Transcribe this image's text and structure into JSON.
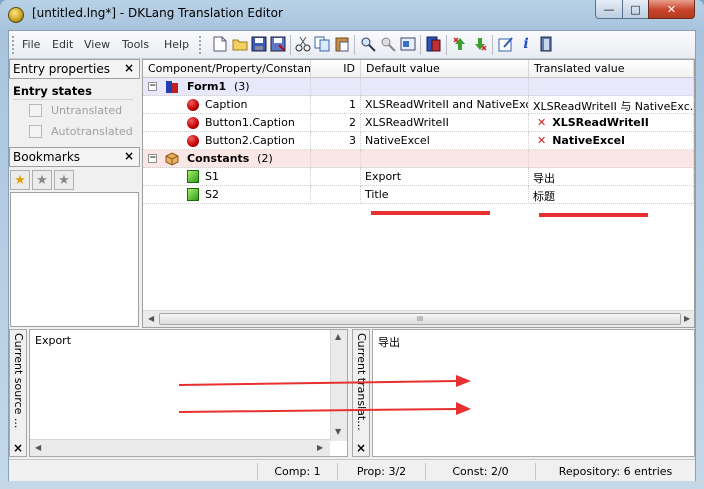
{
  "window": {
    "title": "[untitled.lng*] - DKLang Translation Editor",
    "min_glyph": "—",
    "max_glyph": "□",
    "close_glyph": "✕"
  },
  "menu": [
    "File",
    "Edit",
    "View",
    "Tools",
    "Help"
  ],
  "toolbar_icons": [
    "new-icon",
    "open-icon",
    "save-icon",
    "save-as-icon",
    "cut-icon",
    "copy-icon",
    "paste-icon",
    "find-icon",
    "replace-icon",
    "properties-icon",
    "translation-icon",
    "jump-prev-icon",
    "jump-next-icon",
    "edit-icon",
    "info-icon",
    "exit-icon"
  ],
  "entry_properties": {
    "title": "Entry properties",
    "close": "×",
    "states_header": "Entry states",
    "untranslated": "Untranslated",
    "autotranslated": "Autotranslated"
  },
  "bookmarks": {
    "title": "Bookmarks",
    "close": "×",
    "buttons": [
      "★",
      "★",
      "★"
    ]
  },
  "grid": {
    "columns": [
      "Component/Property/Constant",
      "ID",
      "Default value",
      "Translated value"
    ],
    "rows": [
      {
        "name": "Form1",
        "count": "(3)",
        "id": "",
        "default": "",
        "translated": "",
        "kind": "group-form"
      },
      {
        "name": "Caption",
        "id": "1",
        "default": "XLSReadWriteII and NativeExc...",
        "translated": "XLSReadWriteII 与 NativeExc...",
        "kind": "prop"
      },
      {
        "name": "Button1.Caption",
        "id": "2",
        "default": "XLSReadWriteII",
        "translated": "XLSReadWriteII",
        "kind": "prop-missing"
      },
      {
        "name": "Button2.Caption",
        "id": "3",
        "default": "NativeExcel",
        "translated": "NativeExcel",
        "kind": "prop-missing"
      },
      {
        "name": "Constants",
        "count": "(2)",
        "id": "",
        "default": "",
        "translated": "",
        "kind": "group-const"
      },
      {
        "name": "S1",
        "id": "",
        "default": "Export",
        "translated": "导出",
        "kind": "const"
      },
      {
        "name": "S2",
        "id": "",
        "default": "Title",
        "translated": "标题",
        "kind": "const"
      }
    ],
    "expander_glyph": "−",
    "missing_glyph": "✕",
    "scroll_thumb_grip": "III"
  },
  "source_pane": {
    "label": "Current source ...",
    "text": "Export",
    "close": "×"
  },
  "translation_pane": {
    "label": "Current translat...",
    "text": "导出",
    "close": "×"
  },
  "status": {
    "comp": "Comp: 1",
    "prop": "Prop: 3/2",
    "const": "Const: 2/0",
    "repository": "Repository: 6 entries"
  },
  "annotations": {
    "underline_color": "#e83030",
    "arrow_color": "#e83030"
  }
}
